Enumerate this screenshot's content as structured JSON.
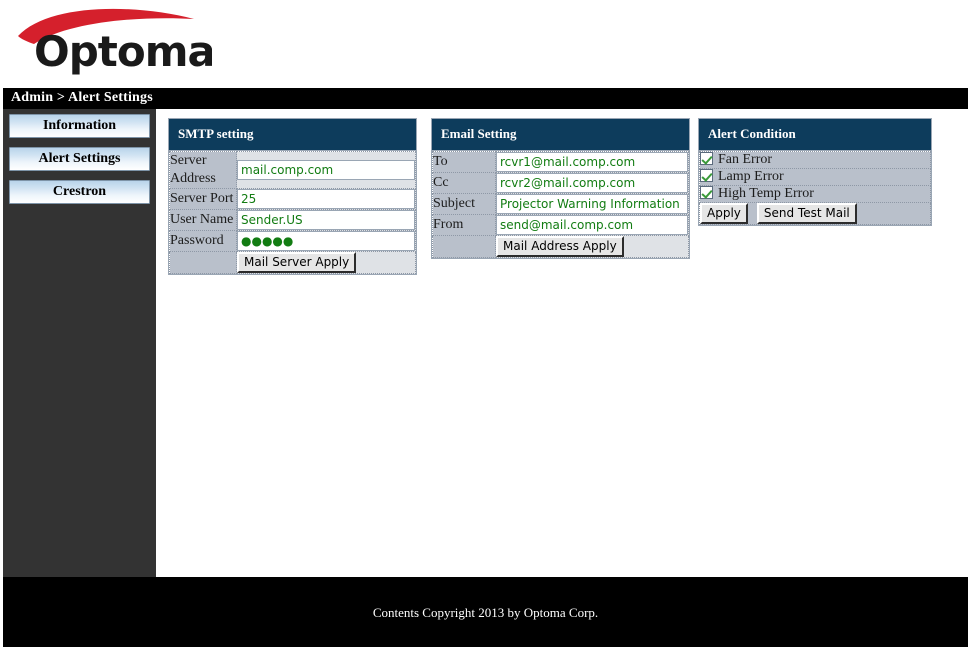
{
  "brand": {
    "logo_text": "Optoma",
    "logo_swoosh_color": "#d5202c",
    "logo_text_color": "#1a1a1a"
  },
  "breadcrumb": {
    "text": "Admin > Alert Settings"
  },
  "sidebar": {
    "items": [
      {
        "label": "Information"
      },
      {
        "label": "Alert Settings"
      },
      {
        "label": "Crestron"
      }
    ]
  },
  "panels": {
    "smtp": {
      "title": "SMTP setting",
      "rows": [
        {
          "label": "Server Address",
          "value": "mail.comp.com",
          "type": "text"
        },
        {
          "label": "Server Port",
          "value": "25",
          "type": "text"
        },
        {
          "label": "User Name",
          "value": "Sender.US",
          "type": "text"
        },
        {
          "label": "Password",
          "value": "●●●●●",
          "type": "password"
        }
      ],
      "apply_button": "Mail Server Apply"
    },
    "email": {
      "title": "Email Setting",
      "rows": [
        {
          "label": "To",
          "value": "rcvr1@mail.comp.com"
        },
        {
          "label": "Cc",
          "value": "rcvr2@mail.comp.com"
        },
        {
          "label": "Subject",
          "value": "Projector Warning Information !"
        },
        {
          "label": "From",
          "value": "send@mail.comp.com"
        }
      ],
      "apply_button": "Mail Address Apply"
    },
    "alert": {
      "title": "Alert Condition",
      "conditions": [
        {
          "label": "Fan Error",
          "checked": true
        },
        {
          "label": "Lamp Error",
          "checked": true
        },
        {
          "label": "High Temp Error",
          "checked": true
        }
      ],
      "apply_button": "Apply",
      "test_button": "Send Test Mail"
    }
  },
  "footer": {
    "copyright": "Contents Copyright 2013 by Optoma Corp."
  },
  "colors": {
    "panel_header": "#0d3c5c",
    "label_cell": "#b9c0cb",
    "value_cell": "#dfe2e6",
    "sidebar": "#333333",
    "bar": "#000000",
    "input_text": "#127c12"
  }
}
